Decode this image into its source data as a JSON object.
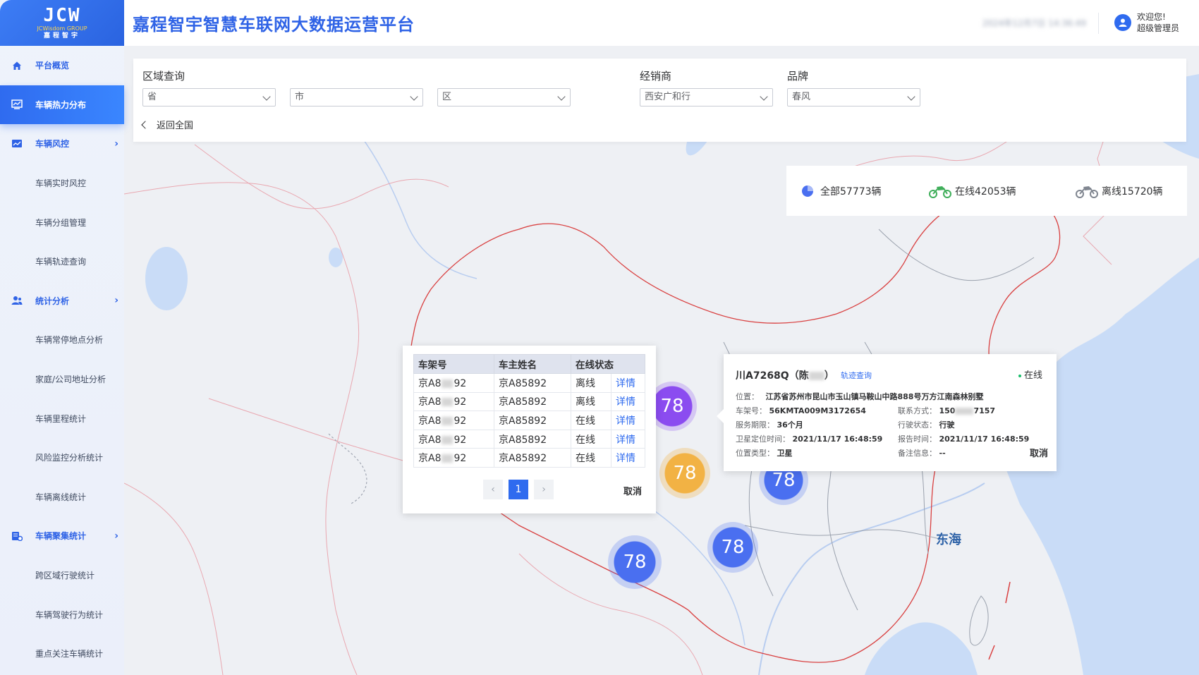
{
  "logo": {
    "mark": "JCW",
    "line1": "JCWisdom GROUP",
    "line2": "嘉程智宇"
  },
  "header": {
    "title": "嘉程智宇智慧车联网大数据运营平台",
    "datetime": "2024年12月7日 14:36:49",
    "welcome": "欢迎您!",
    "role": "超级管理员"
  },
  "sidebar": {
    "items": [
      {
        "label": "平台概览",
        "icon": "home-icon"
      },
      {
        "label": "车辆热力分布",
        "icon": "heatmap-icon"
      },
      {
        "label": "车辆风控",
        "icon": "chart-icon"
      },
      {
        "label": "车辆实时风控"
      },
      {
        "label": "车辆分组管理"
      },
      {
        "label": "车辆轨迹查询"
      },
      {
        "label": "统计分析",
        "icon": "user-group-icon"
      },
      {
        "label": "车辆常停地点分析"
      },
      {
        "label": "家庭/公司地址分析"
      },
      {
        "label": "车辆里程统计"
      },
      {
        "label": "风险监控分析统计"
      },
      {
        "label": "车辆离线统计"
      },
      {
        "label": "车辆聚集统计",
        "icon": "cluster-icon"
      },
      {
        "label": "跨区域行驶统计"
      },
      {
        "label": "车辆驾驶行为统计"
      },
      {
        "label": "重点关注车辆统计"
      }
    ]
  },
  "filter": {
    "region_label": "区域查询",
    "province_placeholder": "省",
    "city_placeholder": "市",
    "district_placeholder": "区",
    "dealer_label": "经销商",
    "dealer_value": "西安广和行",
    "brand_label": "品牌",
    "brand_value": "春风",
    "back_label": "返回全国"
  },
  "stats": {
    "all": "全部57773辆",
    "online": "在线42053辆",
    "offline": "离线15720辆"
  },
  "map": {
    "sea_label": "东海",
    "clusters": [
      {
        "value": "78",
        "color": "#8b4cf0"
      },
      {
        "value": "78",
        "color": "#f2b244"
      },
      {
        "value": "78",
        "color": "#4a6ff0"
      },
      {
        "value": "78",
        "color": "#4a6ff0"
      },
      {
        "value": "78",
        "color": "#4a6ff0"
      }
    ]
  },
  "vehicle_table": {
    "headers": [
      "车架号",
      "车主姓名",
      "在线状态"
    ],
    "rows": [
      {
        "vin_prefix": "京A8",
        "vin_suffix": "92",
        "owner": "京A85892",
        "status": "离线",
        "action": "详情"
      },
      {
        "vin_prefix": "京A8",
        "vin_suffix": "92",
        "owner": "京A85892",
        "status": "离线",
        "action": "详情"
      },
      {
        "vin_prefix": "京A8",
        "vin_suffix": "92",
        "owner": "京A85892",
        "status": "在线",
        "action": "详情"
      },
      {
        "vin_prefix": "京A8",
        "vin_suffix": "92",
        "owner": "京A85892",
        "status": "在线",
        "action": "详情"
      },
      {
        "vin_prefix": "京A8",
        "vin_suffix": "92",
        "owner": "京A85892",
        "status": "在线",
        "action": "详情"
      }
    ],
    "prev": "‹",
    "page": "1",
    "next": "›",
    "cancel": "取消"
  },
  "vehicle_detail": {
    "plate_prefix": "川A7268Q（陈",
    "plate_suffix": "）",
    "track_link": "轨迹查询",
    "status": "在线",
    "location_k": "位置：",
    "location_v": "江苏省苏州市昆山市玉山镇马鞍山中路888号万方江南森林别墅",
    "vin_k": "车架号：",
    "vin_v": "56KMTA009M3172654",
    "phone_k": "联系方式：",
    "phone_prefix": "150",
    "phone_suffix": "7157",
    "service_k": "服务期限：",
    "service_v": "36个月",
    "drive_k": "行驶状态：",
    "drive_v": "行驶",
    "gps_time_k": "卫星定位时间：",
    "gps_time_v": "2021/11/17 16:48:59",
    "report_time_k": "报告时间：",
    "report_time_v": "2021/11/17 16:48:59",
    "loc_type_k": "位置类型：",
    "loc_type_v": "卫星",
    "note_k": "备注信息：",
    "note_v": "--",
    "cancel": "取消"
  }
}
